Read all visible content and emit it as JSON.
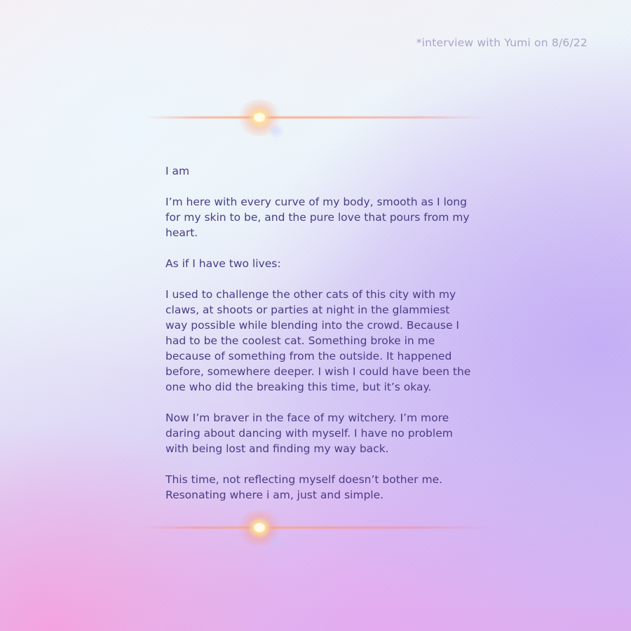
{
  "caption": "*interview with Yumi on 8/6/22",
  "paragraphs": [
    "I am",
    "I’m here with every curve of my body, smooth as I long for my skin to be, and the pure love that pours from my heart.",
    "As if I have two lives:",
    "I used to challenge the other cats of this city with my claws, at shoots or parties at night in the glammiest way possible while blending into the crowd. Because I had to be the coolest cat. Something broke in me because of something from the outside. It happened before, somewhere deeper. I wish I could have been the one who did the breaking this time, but it’s okay.",
    "Now I’m braver in the face of my witchery. I’m more daring about dancing with myself. I have no problem with being lost and finding my way back.",
    "This time, not reflecting myself doesn’t bother me. Resonating where i am, just and simple."
  ],
  "colors": {
    "text": "#4a3c86",
    "caption": "#a9a3c9",
    "flare": "#ff9a70"
  }
}
